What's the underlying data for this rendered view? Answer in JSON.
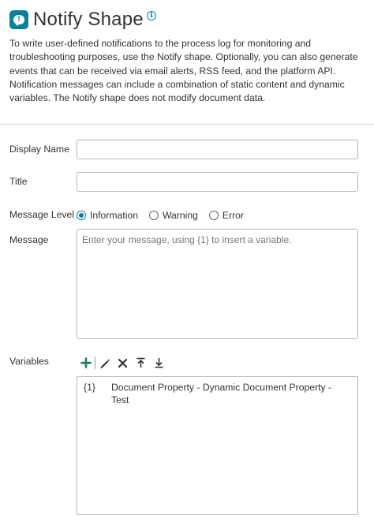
{
  "header": {
    "title": "Notify Shape",
    "icon": "notification-bubble-icon",
    "info_icon": "info-icon"
  },
  "description": "To write user-defined notifications to the process log for monitoring and troubleshooting purposes, use the Notify shape. Optionally, you can also generate events that can be received via email alerts, RSS feed, and the platform API. Notification messages can include a combination of static content and dynamic variables. The Notify shape does not modify document data.",
  "fields": {
    "display_name": {
      "label": "Display Name",
      "value": ""
    },
    "title": {
      "label": "Title",
      "value": ""
    },
    "message_level": {
      "label": "Message Level",
      "options": [
        "Information",
        "Warning",
        "Error"
      ],
      "selected": "Information"
    },
    "message": {
      "label": "Message",
      "placeholder": "Enter your message, using {1} to insert a variable.",
      "value": ""
    }
  },
  "variables": {
    "label": "Variables",
    "toolbar": [
      "add-icon",
      "edit-icon",
      "delete-icon",
      "move-up-icon",
      "move-down-icon"
    ],
    "items": [
      {
        "key": "{1}",
        "value": "Document Property - Dynamic Document Property - Test"
      }
    ]
  },
  "colors": {
    "accent": "#0a7fa3",
    "add_green": "#1e7d5a",
    "text": "#333333",
    "border": "#b5b5b5"
  }
}
